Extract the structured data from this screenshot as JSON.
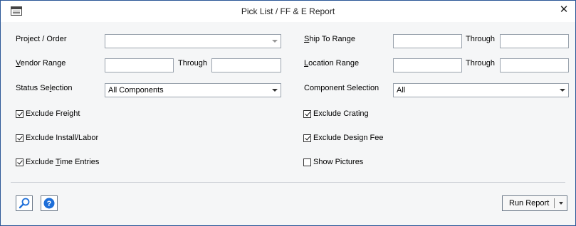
{
  "window": {
    "title": "Pick List / FF & E Report",
    "close_glyph": "✕"
  },
  "fields": {
    "project_order": {
      "label_pre": "Project / Order",
      "value": ""
    },
    "vendor_range": {
      "label_first": "V",
      "label_rest": "endor Range",
      "from": "",
      "through_label": "Through",
      "to": ""
    },
    "status_selection": {
      "label_pre": "Status Se",
      "label_u": "l",
      "label_post": "ection",
      "value": "All Components"
    },
    "ship_to_range": {
      "label_first": "S",
      "label_rest": "hip To Range",
      "from": "",
      "through_label": "Through",
      "to": ""
    },
    "location_range": {
      "label_first": "L",
      "label_rest": "ocation Range",
      "from": "",
      "through_label": "Through",
      "to": ""
    },
    "component_selection": {
      "label": "Component Selection",
      "value": "All"
    }
  },
  "checkboxes": {
    "exclude_freight": {
      "label": "Exclude Freight",
      "checked": true
    },
    "exclude_install": {
      "label": "Exclude Install/Labor",
      "checked": true
    },
    "exclude_time_pre": "Exclude ",
    "exclude_time_u": "T",
    "exclude_time_post": "ime Entries",
    "exclude_time_checked": true,
    "exclude_crating": {
      "label": "Exclude Crating",
      "checked": true
    },
    "exclude_design_fee": {
      "label": "Exclude Design Fee",
      "checked": true
    },
    "show_pictures": {
      "label": "Show Pictures",
      "checked": false
    }
  },
  "footer": {
    "run_report_label": "Run Report"
  },
  "icons": {
    "search": "search-icon",
    "help": "help-icon",
    "window": "window-icon",
    "close": "close-icon",
    "dropdown": "chevron-down-icon"
  },
  "colors": {
    "accent_blue": "#1e6fd9",
    "window_border": "#2b5797",
    "background": "#f5f6f7"
  }
}
